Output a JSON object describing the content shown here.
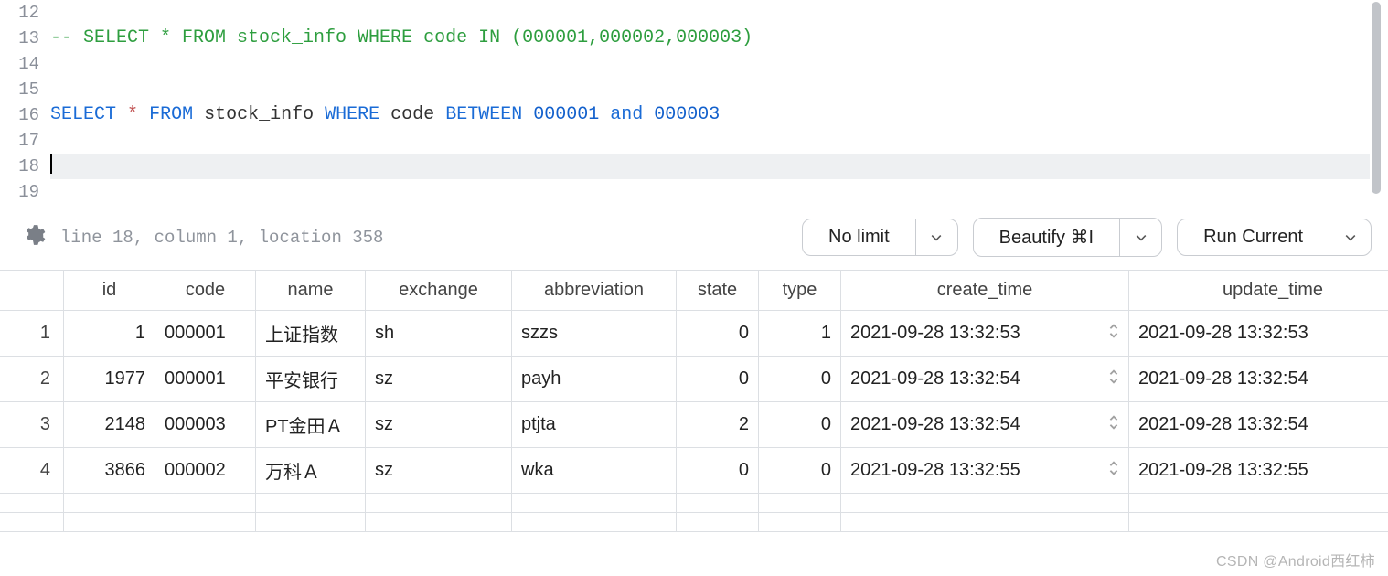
{
  "editor": {
    "lines": [
      12,
      13,
      14,
      15,
      16,
      17,
      18,
      19
    ],
    "current_line": 18,
    "comment_line": "-- SELECT * FROM stock_info WHERE code IN (000001,000002,000003)",
    "query": {
      "kw_select": "SELECT",
      "star": "*",
      "kw_from": "FROM",
      "table": "stock_info",
      "kw_where": "WHERE",
      "col": "code",
      "kw_between": "BETWEEN",
      "lit1": "000001",
      "kw_and": "and",
      "lit2": "000003"
    }
  },
  "status_text": "line 18, column 1, location 358",
  "toolbar": {
    "no_limit": "No limit",
    "beautify": "Beautify ⌘I",
    "run_current": "Run Current"
  },
  "columns": [
    "id",
    "code",
    "name",
    "exchange",
    "abbreviation",
    "state",
    "type",
    "create_time",
    "update_time"
  ],
  "rows": [
    {
      "n": 1,
      "id": "1",
      "code": "000001",
      "name": "上证指数",
      "exchange": "sh",
      "abbreviation": "szzs",
      "state": "0",
      "type": "1",
      "create_time": "2021-09-28 13:32:53",
      "update_time": "2021-09-28 13:32:53"
    },
    {
      "n": 2,
      "id": "1977",
      "code": "000001",
      "name": "平安银行",
      "exchange": "sz",
      "abbreviation": "payh",
      "state": "0",
      "type": "0",
      "create_time": "2021-09-28 13:32:54",
      "update_time": "2021-09-28 13:32:54"
    },
    {
      "n": 3,
      "id": "2148",
      "code": "000003",
      "name": "PT金田Ａ",
      "exchange": "sz",
      "abbreviation": "ptjta",
      "state": "2",
      "type": "0",
      "create_time": "2021-09-28 13:32:54",
      "update_time": "2021-09-28 13:32:54"
    },
    {
      "n": 4,
      "id": "3866",
      "code": "000002",
      "name": "万科Ａ",
      "exchange": "sz",
      "abbreviation": "wka",
      "state": "0",
      "type": "0",
      "create_time": "2021-09-28 13:32:55",
      "update_time": "2021-09-28 13:32:55"
    }
  ],
  "watermark": "CSDN @Android西红柿"
}
